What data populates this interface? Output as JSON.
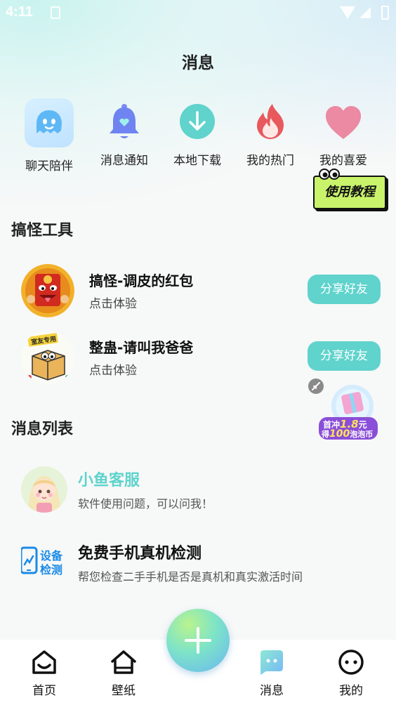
{
  "status_bar": {
    "time": "4:11"
  },
  "header": {
    "title": "消息"
  },
  "quick_actions": [
    {
      "label": "聊天陪伴",
      "icon": "chat-ghost-icon"
    },
    {
      "label": "消息通知",
      "icon": "bell-icon"
    },
    {
      "label": "本地下载",
      "icon": "download-icon"
    },
    {
      "label": "我的热门",
      "icon": "flame-icon"
    },
    {
      "label": "我的喜爱",
      "icon": "heart-icon"
    }
  ],
  "tutorial": {
    "label": "使用教程"
  },
  "tools": {
    "title": "搞怪工具",
    "items": [
      {
        "name": "搞怪-调皮的红包",
        "sub": "点击体验",
        "button": "分享好友",
        "avatar": "red-envelope-devil"
      },
      {
        "name": "整蛊-请叫我爸爸",
        "sub": "点击体验",
        "button": "分享好友",
        "avatar": "box-meme",
        "avatar_text": "室友专用"
      }
    ]
  },
  "promo": {
    "line1a": "首冲",
    "line1b": "1.8",
    "line1c": "元",
    "line2a": "得",
    "line2b": "100",
    "line2c": "泡泡币"
  },
  "messages": {
    "title": "消息列表",
    "items": [
      {
        "name": "小鱼客服",
        "sub": "软件使用问题，可以问我！",
        "name_color": "#5fd3cc"
      },
      {
        "name": "免费手机真机检测",
        "sub": "帮您检查二手手机是否是真机和真实激活时间",
        "icon_text_1": "设备",
        "icon_text_2": "检测",
        "name_color": "#111111"
      }
    ]
  },
  "bottom_nav": [
    {
      "label": "首页",
      "icon": "home-icon"
    },
    {
      "label": "壁纸",
      "icon": "wallpaper-icon"
    },
    {
      "label": "消息",
      "icon": "message-icon",
      "active": true
    },
    {
      "label": "我的",
      "icon": "profile-icon"
    }
  ],
  "colors": {
    "accent": "#5fd3cc",
    "background": "#f7f8f8"
  }
}
